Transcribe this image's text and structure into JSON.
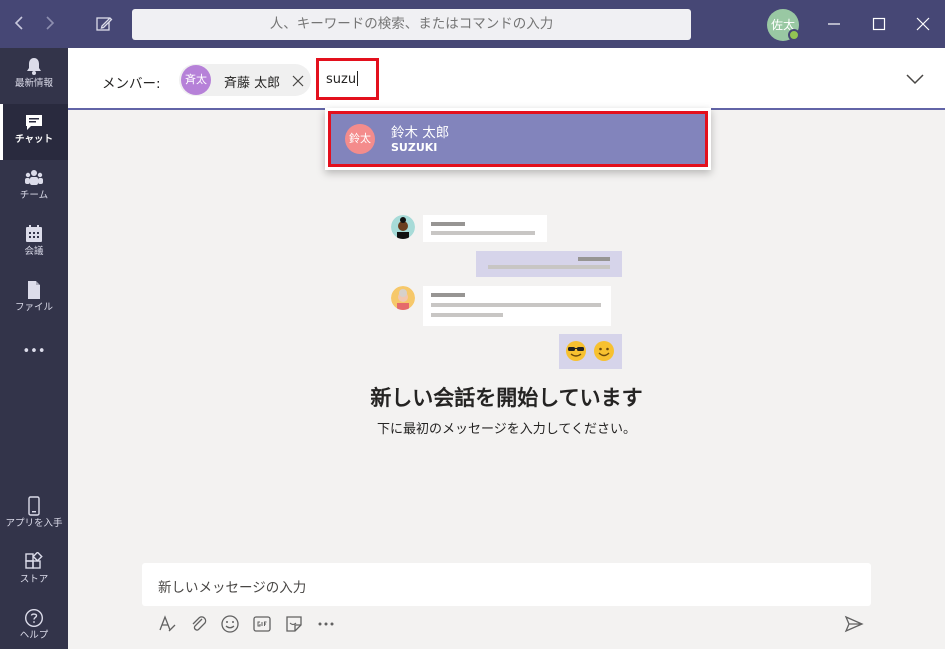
{
  "titlebar": {
    "search_placeholder": "人、キーワードの検索、またはコマンドの入力",
    "me_initials": "佐太",
    "back_glyph": "‹",
    "forward_glyph": "›"
  },
  "rail": {
    "items": [
      {
        "label": "最新情報",
        "icon": "bell-icon"
      },
      {
        "label": "チャット",
        "icon": "chat-icon"
      },
      {
        "label": "チーム",
        "icon": "teams-icon"
      },
      {
        "label": "会議",
        "icon": "calendar-icon"
      },
      {
        "label": "ファイル",
        "icon": "file-icon"
      },
      {
        "label": "•••",
        "icon": "more-icon"
      },
      {
        "label": "アプリを入手",
        "icon": "phone-icon"
      },
      {
        "label": "ストア",
        "icon": "store-icon"
      },
      {
        "label": "ヘルプ",
        "icon": "help-icon"
      }
    ]
  },
  "members": {
    "label": "メンバー:",
    "chip": {
      "initials": "斉太",
      "name": "斉藤 太郎"
    },
    "input_value": "suzu"
  },
  "suggestion": {
    "initials": "鈴太",
    "name": "鈴木 太郎",
    "sub": "SUZUKI"
  },
  "empty_state": {
    "title": "新しい会話を開始しています",
    "subtitle": "下に最初のメッセージを入力してください。"
  },
  "compose": {
    "placeholder": "新しいメッセージの入力",
    "tools": [
      "format-icon",
      "attach-icon",
      "emoji-icon",
      "gif-icon",
      "sticker-icon",
      "more-options-icon"
    ]
  },
  "colors": {
    "titlebar": "#464775",
    "rail": "#33344a",
    "accent": "#6264a7",
    "highlight": "#e3101d"
  }
}
